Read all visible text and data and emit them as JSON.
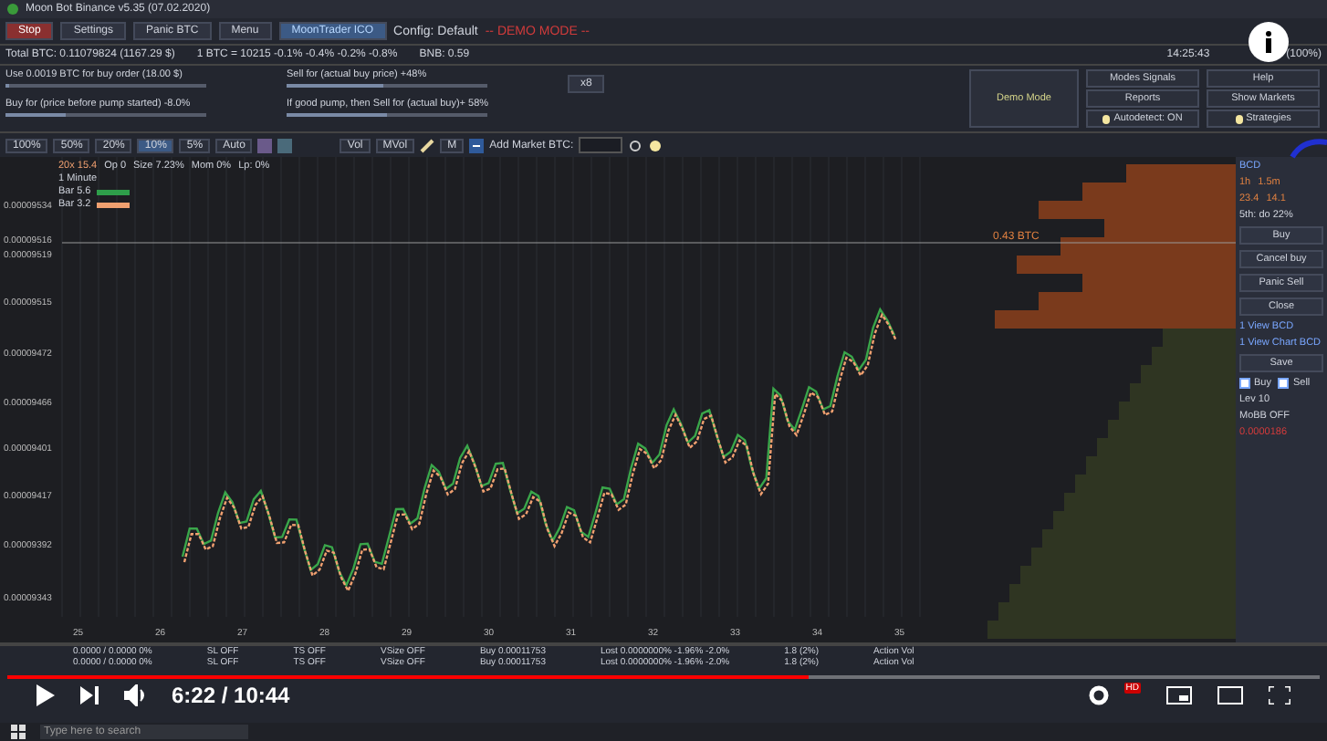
{
  "window": {
    "title": "Moon Bot Binance v5.35 (07.02.2020)"
  },
  "top_buttons": [
    {
      "label": "Stop",
      "selected": false
    },
    {
      "label": "Settings",
      "selected": false
    },
    {
      "label": "Panic BTC",
      "selected": false
    },
    {
      "label": "Menu",
      "selected": false
    },
    {
      "label": "MoonTrader ICO",
      "selected": true
    }
  ],
  "config": "Config: Default",
  "mode_alert": "-- DEMO MODE --",
  "status_bar": {
    "total": "Total BTC: 0.11079824 (1167.29 $)",
    "rate": "1 BTC = 10215  -0.1%  -0.4%  -0.2%  -0.8%",
    "bnb": "BNB: 0.59",
    "time": "14:25:43",
    "zoom": "(100%)"
  },
  "sliders": [
    {
      "label": "Use 0.0019 BTC for buy order  (18.00 $)",
      "level": 0.02
    },
    {
      "label": "Buy for (price before pump started) -8.0%",
      "level": 0.3
    },
    {
      "label": "Sell for (actual buy price) +48%",
      "level": 0.48
    },
    {
      "label": "If good pump, then Sell for (actual buy)+ 58%",
      "level": 0.5
    }
  ],
  "multiplier_button": "x8",
  "demo_mode": "Demo Mode",
  "side_buttons": [
    {
      "label": "Modes Signals",
      "kind": "plain"
    },
    {
      "label": "Help",
      "kind": "plain"
    },
    {
      "label": "Reports",
      "kind": "plain"
    },
    {
      "label": "Show Markets",
      "kind": "plain"
    },
    {
      "label": "Autodetect: ON",
      "kind": "lamp"
    },
    {
      "label": "Strategies",
      "kind": "lamp"
    }
  ],
  "toolbar": {
    "percents": [
      {
        "label": "100%",
        "selected": false
      },
      {
        "label": "50%",
        "selected": false
      },
      {
        "label": "20%",
        "selected": false
      },
      {
        "label": "10%",
        "selected": true
      },
      {
        "label": "5%",
        "selected": false
      }
    ],
    "auto": "Auto",
    "vol": "Vol",
    "mvol": "MVol",
    "m": "M",
    "add_market": "Add Market BTC:"
  },
  "chart": {
    "legend": [
      "20x 15.4",
      "Op 0",
      "Size 7.23%",
      "Mom 0%",
      "Lp: 0%"
    ],
    "interval": "1 Minute",
    "bars": [
      {
        "label": "Bar 5.6",
        "color": "#2e9e4a"
      },
      {
        "label": "Bar 3.2",
        "color": "#f0a070"
      }
    ],
    "y_labels": [
      "0.00009534",
      "0.00009516",
      "0.00009519",
      "0.00009515",
      "0.00009472",
      "0.00009466",
      "0.00009401",
      "0.00009417",
      "0.00009392",
      "0.00009343"
    ],
    "x_labels": [
      "25",
      "26",
      "27",
      "28",
      "29",
      "30",
      "31",
      "32",
      "33",
      "34",
      "35"
    ],
    "order_label": "0.43 BTC"
  },
  "coin_panel": {
    "coin": "BCD",
    "col_1": "1h",
    "col_2": "1.5m",
    "val_1": "23.4",
    "val_2": "14.1",
    "info": "5th: do 22%",
    "buy": "Buy",
    "cancel_buy": "Cancel buy",
    "panic_sell": "Panic Sell",
    "close": "Close",
    "views": [
      "1 View BCD",
      "1 View Chart BCD"
    ],
    "save": "Save",
    "checks": [
      {
        "label": "Buy",
        "checked": false
      },
      {
        "label": "Sell",
        "checked": false
      }
    ],
    "lev": "Lev 10",
    "mobb": "MoBB OFF",
    "price": "0.0000186"
  },
  "orders": [
    {
      "cells": [
        "0.0000 / 0.0000  0%",
        "SL OFF",
        "TS OFF",
        "VSize OFF",
        "Buy 0.00011753",
        "Lost 0.0000000% -1.96% -2.0%",
        "1.8 (2%)",
        "Action Vol"
      ]
    },
    {
      "cells": [
        "0.0000 / 0.0000  0%",
        "SL OFF",
        "TS OFF",
        "VSize OFF",
        "Buy 0.00011753",
        "Lost 0.0000000% -1.96% -2.0%",
        "1.8 (2%)",
        "Action Vol"
      ]
    }
  ],
  "player": {
    "time": "6:22 / 10:44",
    "quality": "HD",
    "progress": {
      "level": 0.61
    }
  },
  "taskbar": {
    "search": {
      "placeholder": "Type here to search"
    }
  }
}
